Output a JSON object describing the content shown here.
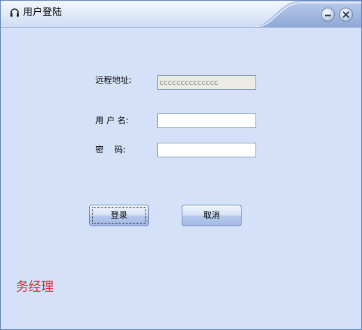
{
  "window": {
    "title": "用户登陆",
    "icon": "headphones-icon"
  },
  "form": {
    "remote_address": {
      "label": "远程地址:",
      "value": "cccccccccccccc"
    },
    "username": {
      "label": "用 户 名:",
      "value": ""
    },
    "password": {
      "label": "密    码:",
      "value": ""
    }
  },
  "buttons": {
    "login_label": "登录",
    "cancel_label": "取消"
  },
  "brand": {
    "text": "务经理"
  },
  "colors": {
    "window_bg": "#d4e1f8",
    "brand_text": "#e8202a",
    "border": "#5a7fb8"
  }
}
